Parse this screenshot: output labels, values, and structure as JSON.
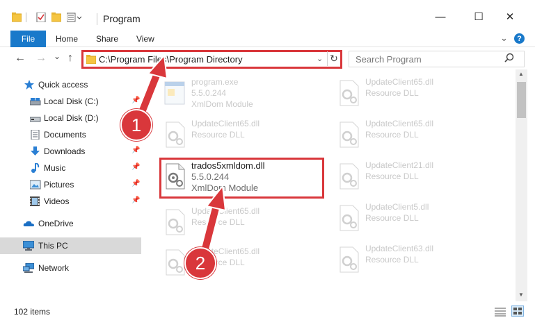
{
  "window": {
    "title": "Program",
    "minimize_glyph": "—",
    "maximize_glyph": "☐",
    "close_glyph": "✕"
  },
  "ribbon": {
    "tabs": [
      "File",
      "Home",
      "Share",
      "View"
    ],
    "help_glyph": "?"
  },
  "address": {
    "path": "C:\\Program Files\\Program Directory",
    "refresh_glyph": "↻"
  },
  "search": {
    "placeholder": "Search Program"
  },
  "nav": {
    "back": "←",
    "forward": "→",
    "dropdown": "⌄",
    "up": "↑"
  },
  "sidebar": {
    "items": [
      {
        "label": "Quick access",
        "icon": "star-icon"
      },
      {
        "label": "Local Disk (C:)",
        "icon": "drive-icon",
        "pinned": true
      },
      {
        "label": "Local Disk (D:)",
        "icon": "drive-icon"
      },
      {
        "label": "Documents",
        "icon": "documents-icon",
        "pinned": true
      },
      {
        "label": "Downloads",
        "icon": "download-icon",
        "pinned": true
      },
      {
        "label": "Music",
        "icon": "music-icon",
        "pinned": true
      },
      {
        "label": "Pictures",
        "icon": "pictures-icon",
        "pinned": true
      },
      {
        "label": "Videos",
        "icon": "videos-icon",
        "pinned": true
      },
      {
        "label": "OneDrive",
        "icon": "onedrive-icon"
      },
      {
        "label": "This PC",
        "icon": "computer-icon",
        "selected": true
      },
      {
        "label": "Network",
        "icon": "network-icon"
      }
    ]
  },
  "files": {
    "left_column": [
      {
        "name": "program.exe",
        "line2": "5.5.0.244",
        "line3": "XmlDom Module",
        "icon": "exe-icon"
      },
      {
        "name": "UpdateClient65.dll",
        "line2": "Resource DLL",
        "icon": "dll-icon"
      },
      {
        "name": "trados5xmldom.dll",
        "line2": "5.5.0.244",
        "line3": "XmlDom Module",
        "icon": "dll-icon",
        "highlighted": true
      },
      {
        "name": "UpdateClient65.dll",
        "line2": "Resource DLL",
        "icon": "dll-icon"
      },
      {
        "name": "UpdateClient65.dll",
        "line2": "Resource DLL",
        "icon": "dll-icon"
      }
    ],
    "right_column": [
      {
        "name": "UpdateClient65.dll",
        "line2": "Resource DLL",
        "icon": "dll-icon"
      },
      {
        "name": "UpdateClient65.dll",
        "line2": "Resource DLL",
        "icon": "dll-icon"
      },
      {
        "name": "UpdateClient21.dll",
        "line2": "Resource DLL",
        "icon": "dll-icon"
      },
      {
        "name": "UpdateClient5.dll",
        "line2": "Resource DLL",
        "icon": "dll-icon"
      },
      {
        "name": "UpdateClient63.dll",
        "line2": "Resource DLL",
        "icon": "dll-icon"
      }
    ]
  },
  "status": {
    "item_count": "102 items"
  },
  "callouts": [
    "1",
    "2"
  ],
  "colors": {
    "accent": "#1979ca",
    "annotation_red": "#d9373b",
    "selected_bg": "#d9d9d9"
  }
}
